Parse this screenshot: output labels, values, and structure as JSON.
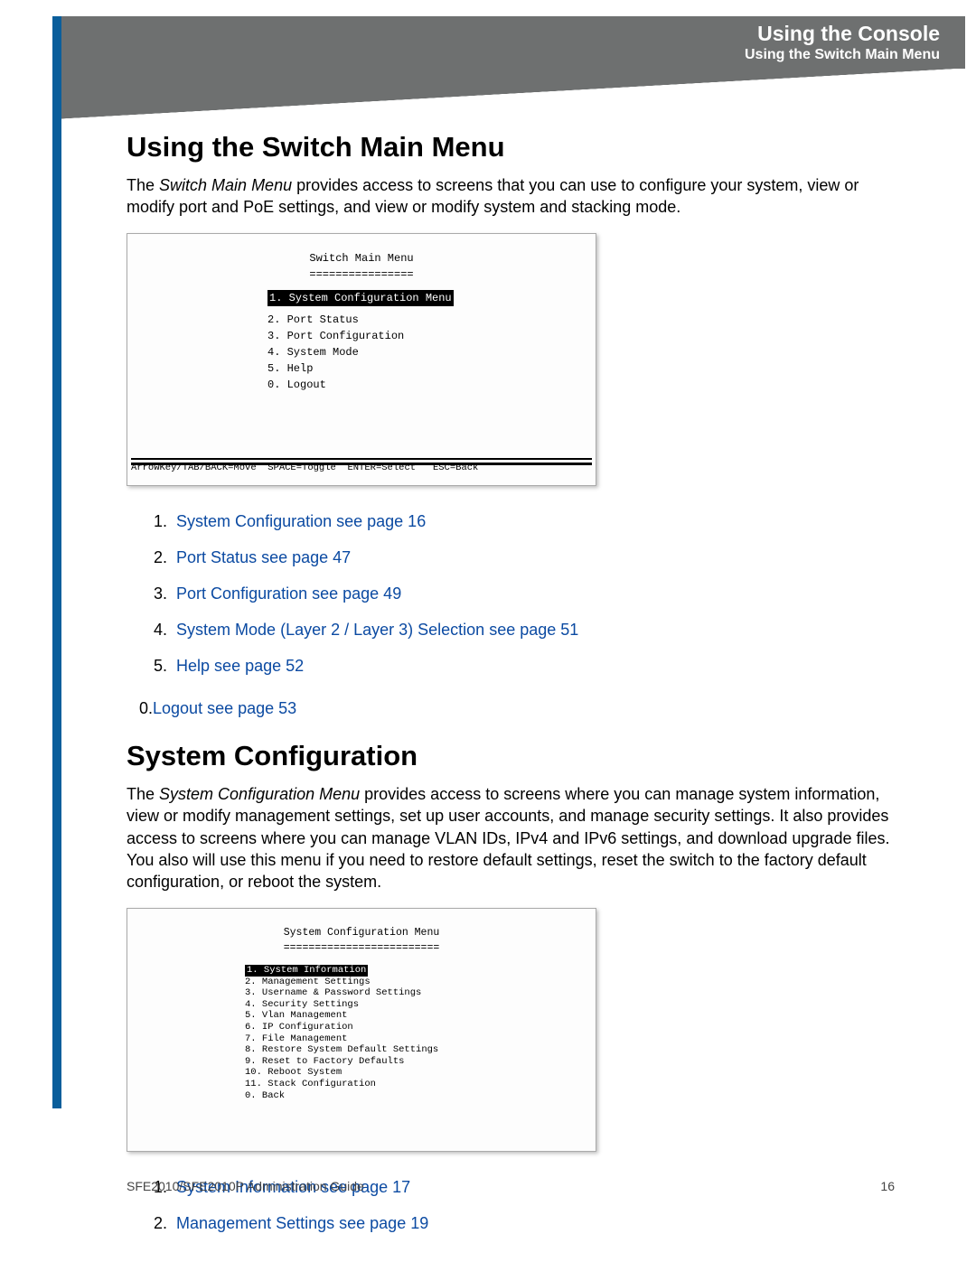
{
  "header": {
    "line1": "Using the Console",
    "line2": "Using the Switch Main Menu"
  },
  "section1": {
    "heading": "Using the Switch Main Menu",
    "intro_pre": "The ",
    "intro_ital": "Switch Main Menu",
    "intro_post": " provides access to screens that you can use to configure your system, view or modify port and PoE settings, and view or modify system and stacking mode."
  },
  "terminal1": {
    "title": "Switch Main Menu",
    "title_underline": "================",
    "selected": "1. System Configuration Menu",
    "items": [
      "2. Port Status",
      "3. Port Configuration",
      "4. System Mode",
      "5. Help",
      "0. Logout"
    ],
    "footer": "ArrowKey/TAB/BACK=Move  SPACE=Toggle  ENTER=Select   ESC=Back"
  },
  "links1": [
    {
      "num": "1.",
      "text": "System Configuration see page 16"
    },
    {
      "num": "2.",
      "text": "Port Status see page 47"
    },
    {
      "num": "3.",
      "text": "Port Configuration see page 49"
    },
    {
      "num": "4.",
      "text": "System Mode (Layer 2 / Layer 3) Selection see page 51"
    },
    {
      "num": "5.",
      "text": "Help see page 52"
    }
  ],
  "links1_zero": {
    "num": "0.",
    "text": "Logout see page 53"
  },
  "section2": {
    "heading": "System Configuration",
    "intro_pre": "The ",
    "intro_ital": "System Configuration Menu",
    "intro_post": " provides access to screens where you can manage system information, view or modify management settings, set up user accounts, and manage security settings. It also provides access to screens where you can manage VLAN IDs, IPv4 and IPv6 settings, and download upgrade files. You also will use this menu if you need to restore default settings, reset the switch to the factory default configuration, or reboot the system."
  },
  "terminal2": {
    "title": "System Configuration Menu",
    "title_underline": "=========================",
    "selected": "1. System Information",
    "items": [
      "2. Management Settings",
      "3. Username & Password Settings",
      "4. Security Settings",
      "5. Vlan Management",
      "6. IP Configuration",
      "7. File Management",
      "8. Restore System Default Settings",
      "9. Reset to Factory Defaults",
      "10. Reboot System",
      "11. Stack Configuration",
      "0. Back"
    ]
  },
  "links2": [
    {
      "num": "1.",
      "text": "System Information see page 17"
    },
    {
      "num": "2.",
      "text": "Management Settings see page 19"
    }
  ],
  "footer": {
    "left": "SFE2010/SFE2010P Administration Guide",
    "right": "16"
  }
}
